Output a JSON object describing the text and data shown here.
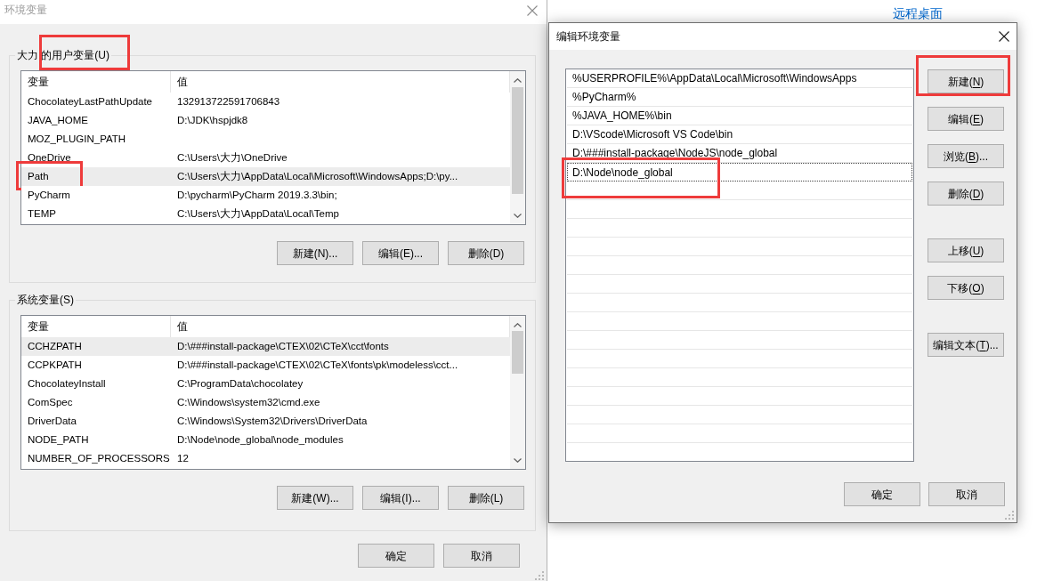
{
  "desktop": {
    "link": "远程桌面"
  },
  "env_dialog": {
    "title": "环境变量",
    "active": false,
    "user_vars": {
      "label": "大力 的用户变量(U)",
      "marked": true,
      "columns": [
        "变量",
        "值"
      ],
      "rows": [
        {
          "name": "ChocolateyLastPathUpdate",
          "value": "132913722591706843",
          "selected": false,
          "marked": false
        },
        {
          "name": "JAVA_HOME",
          "value": "D:\\JDK\\hspjdk8",
          "selected": false,
          "marked": false
        },
        {
          "name": "MOZ_PLUGIN_PATH",
          "selected": false,
          "marked": false
        },
        {
          "name": "OneDrive",
          "value": "C:\\Users\\大力\\OneDrive",
          "selected": false,
          "marked": false
        },
        {
          "name": "Path",
          "value": "C:\\Users\\大力\\AppData\\Local\\Microsoft\\WindowsApps;D:\\py...",
          "selected": true,
          "marked": true
        },
        {
          "name": "PyCharm",
          "value": "D:\\pycharm\\PyCharm 2019.3.3\\bin;",
          "selected": false,
          "marked": false
        },
        {
          "name": "TEMP",
          "value": "C:\\Users\\大力\\AppData\\Local\\Temp",
          "selected": false,
          "marked": false
        }
      ],
      "buttons": [
        "新建(N)...",
        "编辑(E)...",
        "删除(D)"
      ]
    },
    "system_vars": {
      "label": "系统变量(S)",
      "marked": false,
      "columns": [
        "变量",
        "值"
      ],
      "rows": [
        {
          "name": "CCHZPATH",
          "value": "D:\\###install-package\\CTEX\\02\\CTeX\\cct\\fonts",
          "selected": true,
          "marked": false
        },
        {
          "name": "CCPKPATH",
          "value": "D:\\###install-package\\CTEX\\02\\CTeX\\fonts\\pk\\modeless\\cct...",
          "selected": false,
          "marked": false
        },
        {
          "name": "ChocolateyInstall",
          "value": "C:\\ProgramData\\chocolatey",
          "selected": false,
          "marked": false
        },
        {
          "name": "ComSpec",
          "value": "C:\\Windows\\system32\\cmd.exe",
          "selected": false,
          "marked": false
        },
        {
          "name": "DriverData",
          "value": "C:\\Windows\\System32\\Drivers\\DriverData",
          "selected": false,
          "marked": false
        },
        {
          "name": "NODE_PATH",
          "value": "D:\\Node\\node_global\\node_modules",
          "selected": false,
          "marked": false
        },
        {
          "name": "NUMBER_OF_PROCESSORS",
          "value": "12",
          "selected": false,
          "marked": false
        }
      ],
      "buttons": [
        "新建(W)...",
        "编辑(I)...",
        "删除(L)"
      ]
    },
    "buttons": [
      "确定",
      "取消"
    ]
  },
  "edit_dialog": {
    "title": "编辑环境变量",
    "active": true,
    "entries": [
      {
        "text": "%USERPROFILE%\\AppData\\Local\\Microsoft\\WindowsApps",
        "selected": false,
        "marked": false
      },
      {
        "text": "%PyCharm%",
        "selected": false,
        "marked": false
      },
      {
        "text": "%JAVA_HOME%\\bin",
        "selected": false,
        "marked": false
      },
      {
        "text": "D:\\VScode\\Microsoft VS Code\\bin",
        "selected": false,
        "marked": false
      },
      {
        "text": "D:\\###install-package\\NodeJS\\node_global",
        "selected": false,
        "marked": false
      },
      {
        "text": "D:\\Node\\node_global",
        "selected": true,
        "marked": true
      }
    ],
    "side_buttons": [
      [
        {
          "before": "新建(",
          "key": "N",
          "after": ")",
          "marked": true
        },
        {
          "before": "编辑(",
          "key": "E",
          "after": ")",
          "marked": false
        },
        {
          "before": "浏览(",
          "key": "B",
          "after": ")...",
          "marked": false
        },
        {
          "before": "删除(",
          "key": "D",
          "after": ")",
          "marked": false
        }
      ],
      [
        {
          "before": "上移(",
          "key": "U",
          "after": ")",
          "marked": false
        },
        {
          "before": "下移(",
          "key": "O",
          "after": ")",
          "marked": false
        }
      ],
      [
        {
          "before": "编辑文本(",
          "key": "T",
          "after": ")...",
          "marked": false
        }
      ]
    ],
    "buttons": [
      "确定",
      "取消"
    ]
  }
}
